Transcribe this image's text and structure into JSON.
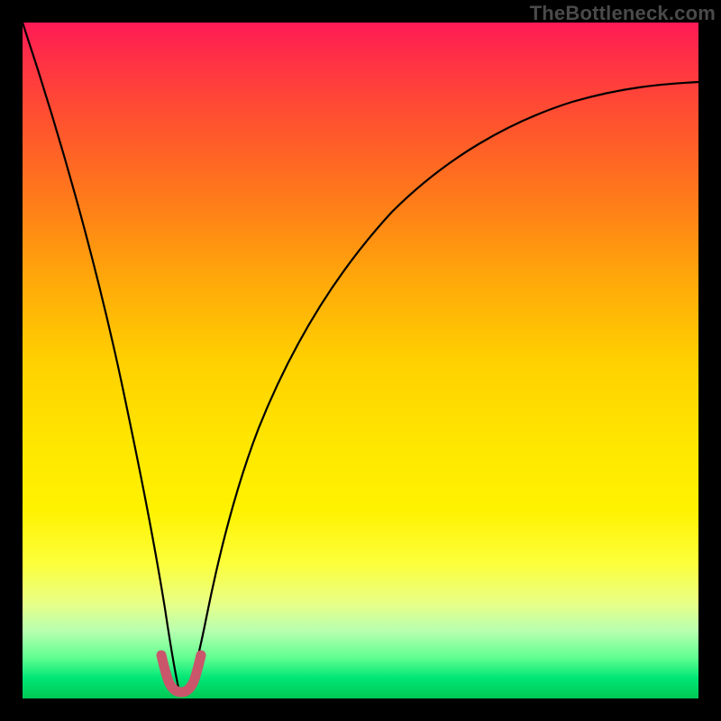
{
  "watermark": "TheBottleneck.com",
  "chart_data": {
    "type": "line",
    "title": "",
    "xlabel": "",
    "ylabel": "",
    "xlim": [
      0,
      100
    ],
    "ylim": [
      0,
      100
    ],
    "grid": false,
    "notes": "Background is a vertical heatmap gradient from red (top, high bottleneck) to green (bottom, optimal). Curve shows bottleneck percentage; minimum near x≈23 indicates balanced configuration. A short pink marker highlights the trough region.",
    "series": [
      {
        "name": "bottleneck-curve",
        "color": "#000000",
        "x": [
          0,
          5,
          10,
          13,
          16,
          18,
          20,
          21.5,
          23,
          25,
          27,
          30,
          35,
          40,
          45,
          50,
          55,
          60,
          65,
          70,
          75,
          80,
          85,
          90,
          95,
          100
        ],
        "y": [
          100,
          78,
          56,
          42,
          28,
          18,
          10,
          4,
          1,
          3,
          8,
          16,
          28,
          38,
          46,
          53,
          59,
          64,
          69,
          73,
          76,
          79,
          81,
          83,
          85,
          86
        ]
      },
      {
        "name": "optimal-marker",
        "color": "#c9566a",
        "x": [
          20.5,
          21,
          21.5,
          22,
          22.5,
          23,
          23.5,
          24,
          24.5,
          25,
          25.5
        ],
        "y": [
          5,
          3.5,
          2.4,
          1.6,
          1.1,
          1,
          1.2,
          1.8,
          2.6,
          3.6,
          5
        ]
      }
    ]
  }
}
